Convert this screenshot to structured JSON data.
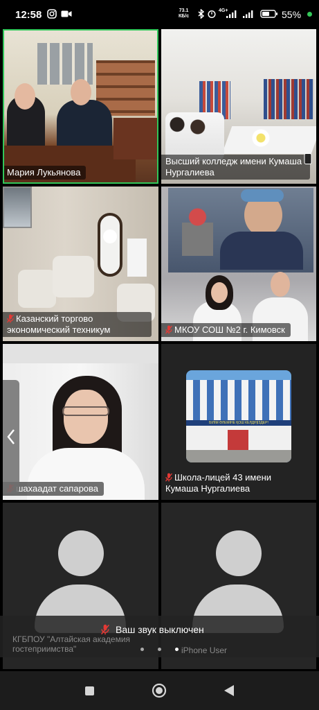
{
  "status_bar": {
    "time": "12:58",
    "speed_value": "73.1",
    "speed_unit": "КБ/с",
    "network": "4G+",
    "battery": "55%",
    "icons": [
      "instagram-icon",
      "video-icon",
      "bluetooth-icon",
      "signal-icon",
      "wifi-icon",
      "battery-icon"
    ]
  },
  "participants": [
    {
      "name": "Мария Лукьянова",
      "muted": false,
      "active_speaker": true
    },
    {
      "name": "Высший колледж имени Кумаша Нургалиева",
      "muted": false,
      "active_speaker": false
    },
    {
      "name": "Казанский торгово экономический техникум",
      "muted": true,
      "active_speaker": false
    },
    {
      "name": "МКОУ СОШ №2 г. Кимовск",
      "muted": true,
      "active_speaker": false
    },
    {
      "name": "шахаадат сапарова",
      "muted": true,
      "active_speaker": false
    },
    {
      "name": "Школа-лицей 43 имени Кумаша Нургалиева",
      "muted": true,
      "active_speaker": false
    },
    {
      "name": "КГБПОУ \"Алтайская академия гостеприимства\"",
      "muted": false,
      "active_speaker": false
    },
    {
      "name": "iPhone User",
      "muted": false,
      "active_speaker": false
    }
  ],
  "building_sign": "БІЛІМ ӘЛЕМІНЕ ҚОШ КЕЛДІҢІЗДЕР!",
  "toast": {
    "text": "Ваш звук выключен"
  },
  "colors": {
    "active_border": "#31c75a",
    "muted_mic": "#e53935",
    "avatar": "#cfcfcf"
  },
  "nav": [
    "recents-square-icon",
    "home-circle-icon",
    "back-triangle-icon"
  ]
}
